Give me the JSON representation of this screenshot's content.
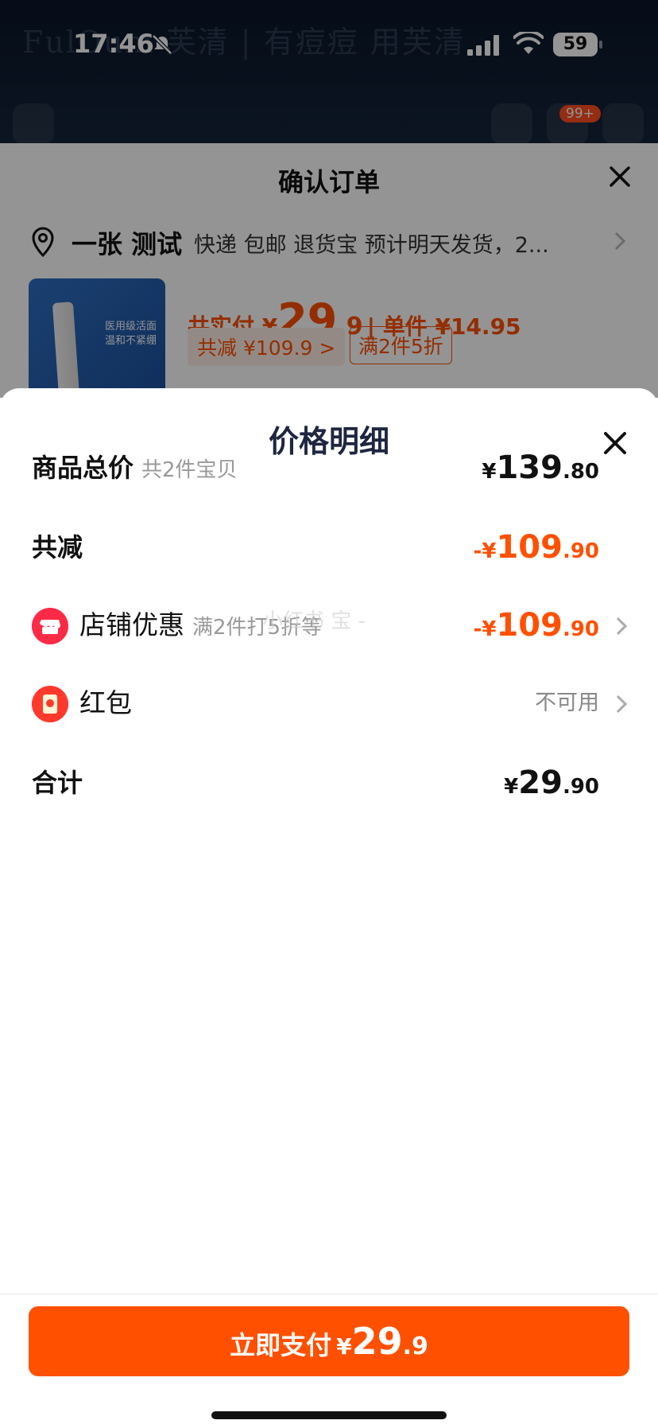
{
  "status_bar": {
    "time": "17:46",
    "battery": "59"
  },
  "background": {
    "brand_banner": "FulOum 芙清 | 有痘痘 用芙清",
    "cart_badge": "99+"
  },
  "order_sheet": {
    "title": "确认订单",
    "address_name": "一张 测试",
    "address_info": "快递 包邮 退货宝 预计明天发货，2...",
    "pay_label": "共实付 ¥",
    "pay_int": "29",
    "pay_dec": ".9",
    "unit_label": "| 单件 ¥14.95",
    "save_chip": "共减 ¥109.9 >",
    "promo_chip": "满2件5折",
    "product_tag": "医用级活面 温和不紧绷"
  },
  "modal": {
    "title": "价格明细",
    "rows": {
      "total": {
        "label": "商品总价",
        "sub": "共2件宝贝",
        "cur": "¥",
        "int": "139",
        "dec": ".80"
      },
      "reduce": {
        "label": "共减",
        "cur": "-¥",
        "int": "109",
        "dec": ".90"
      },
      "shop": {
        "label": "店铺优惠",
        "sub": "满2件打5折等",
        "cur": "-¥",
        "int": "109",
        "dec": ".90"
      },
      "hongbao": {
        "label": "红包",
        "status": "不可用"
      },
      "sum": {
        "label": "合计",
        "cur": "¥",
        "int": "29",
        "dec": ".90"
      }
    },
    "watermark": "小红书 宝 -",
    "pay_button": {
      "label": "立即支付",
      "cur": "¥",
      "int": "29",
      "dec": ".9"
    }
  },
  "colors": {
    "accent": "#ff5000",
    "shop_icon": "#ff2a46",
    "hongbao_icon": "#ff3a2c"
  }
}
